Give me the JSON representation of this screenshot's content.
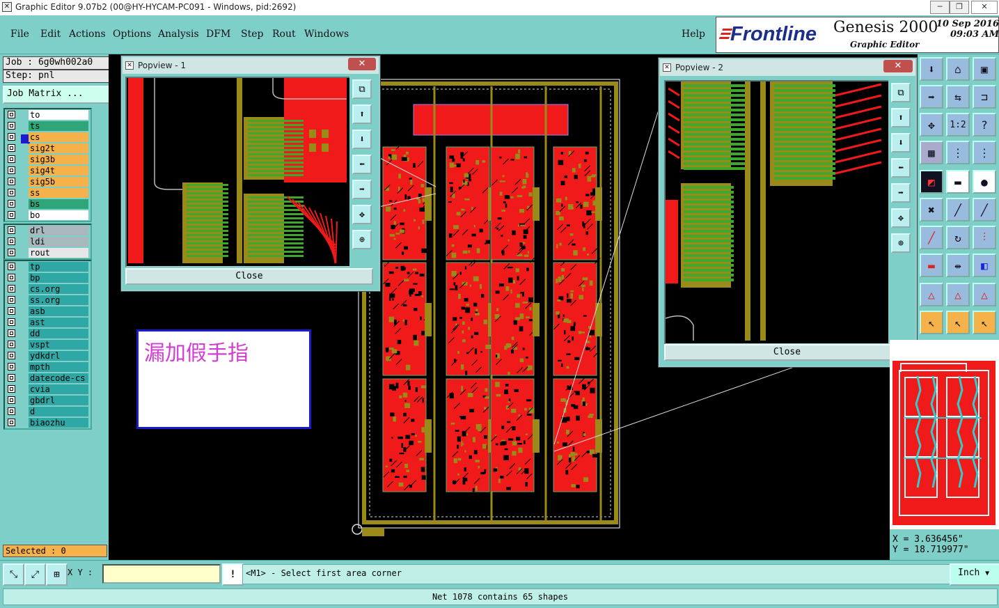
{
  "window": {
    "title": "Graphic Editor 9.07b2 (00@HY-HYCAM-PC091 - Windows, pid:2692)"
  },
  "menu": [
    "File",
    "Edit",
    "Actions",
    "Options",
    "Analysis",
    "DFM",
    "Step",
    "Rout",
    "Windows"
  ],
  "help": "Help",
  "logo": {
    "brand": "Frontline",
    "product": "Genesis 2000",
    "subtitle": "Graphic Editor",
    "date": "10 Sep 2016",
    "time": "09:03 AM"
  },
  "job": {
    "job": "Job : 6g0wh002a0",
    "step": "Step: pnl",
    "matrix_button": "Job Matrix ..."
  },
  "layers": {
    "group1": [
      {
        "name": "to",
        "color": "#ffffff"
      },
      {
        "name": "ts",
        "color": "#2fa67a"
      },
      {
        "name": "cs",
        "color": "#f5b24a"
      },
      {
        "name": "sig2t",
        "color": "#f5b24a"
      },
      {
        "name": "sig3b",
        "color": "#f5b24a"
      },
      {
        "name": "sig4t",
        "color": "#f5b24a"
      },
      {
        "name": "sig5b",
        "color": "#f5b24a"
      },
      {
        "name": "ss",
        "color": "#f5b24a"
      },
      {
        "name": "bs",
        "color": "#2fa67a"
      },
      {
        "name": "bo",
        "color": "#ffffff"
      }
    ],
    "group2": [
      {
        "name": "drl",
        "color": "#a8b8bc"
      },
      {
        "name": "ldi",
        "color": "#a8b8bc"
      },
      {
        "name": "rout",
        "color": "#e6e6e6"
      }
    ],
    "group3": [
      "tp",
      "bp",
      "cs.org",
      "ss.org",
      "asb",
      "ast",
      "dd",
      "vspt",
      "ydkdrl",
      "mpth",
      "datecode-cs",
      "cvia",
      "gbdrl",
      "d",
      "biaozhu"
    ],
    "group3_color": "#2fa7a4"
  },
  "selected": "Selected : 0",
  "popview1": {
    "title": "Popview - 1",
    "close": "Close"
  },
  "popview2": {
    "title": "Popview - 2",
    "close": "Close"
  },
  "note": {
    "text": "漏加假手指"
  },
  "coords": {
    "x": "X = 3.636456\"",
    "y": "Y = 18.719977\""
  },
  "xy_label": "X Y :",
  "xy_value": "",
  "prompt": "<M1> - Select first area corner",
  "units": "Inch",
  "status": "Net 1078 contains 65 shapes",
  "colors": {
    "panel": "#7fcfc9",
    "copper": "#f01a1a",
    "gold": "#9a8a1a",
    "green": "#3fa82a"
  }
}
